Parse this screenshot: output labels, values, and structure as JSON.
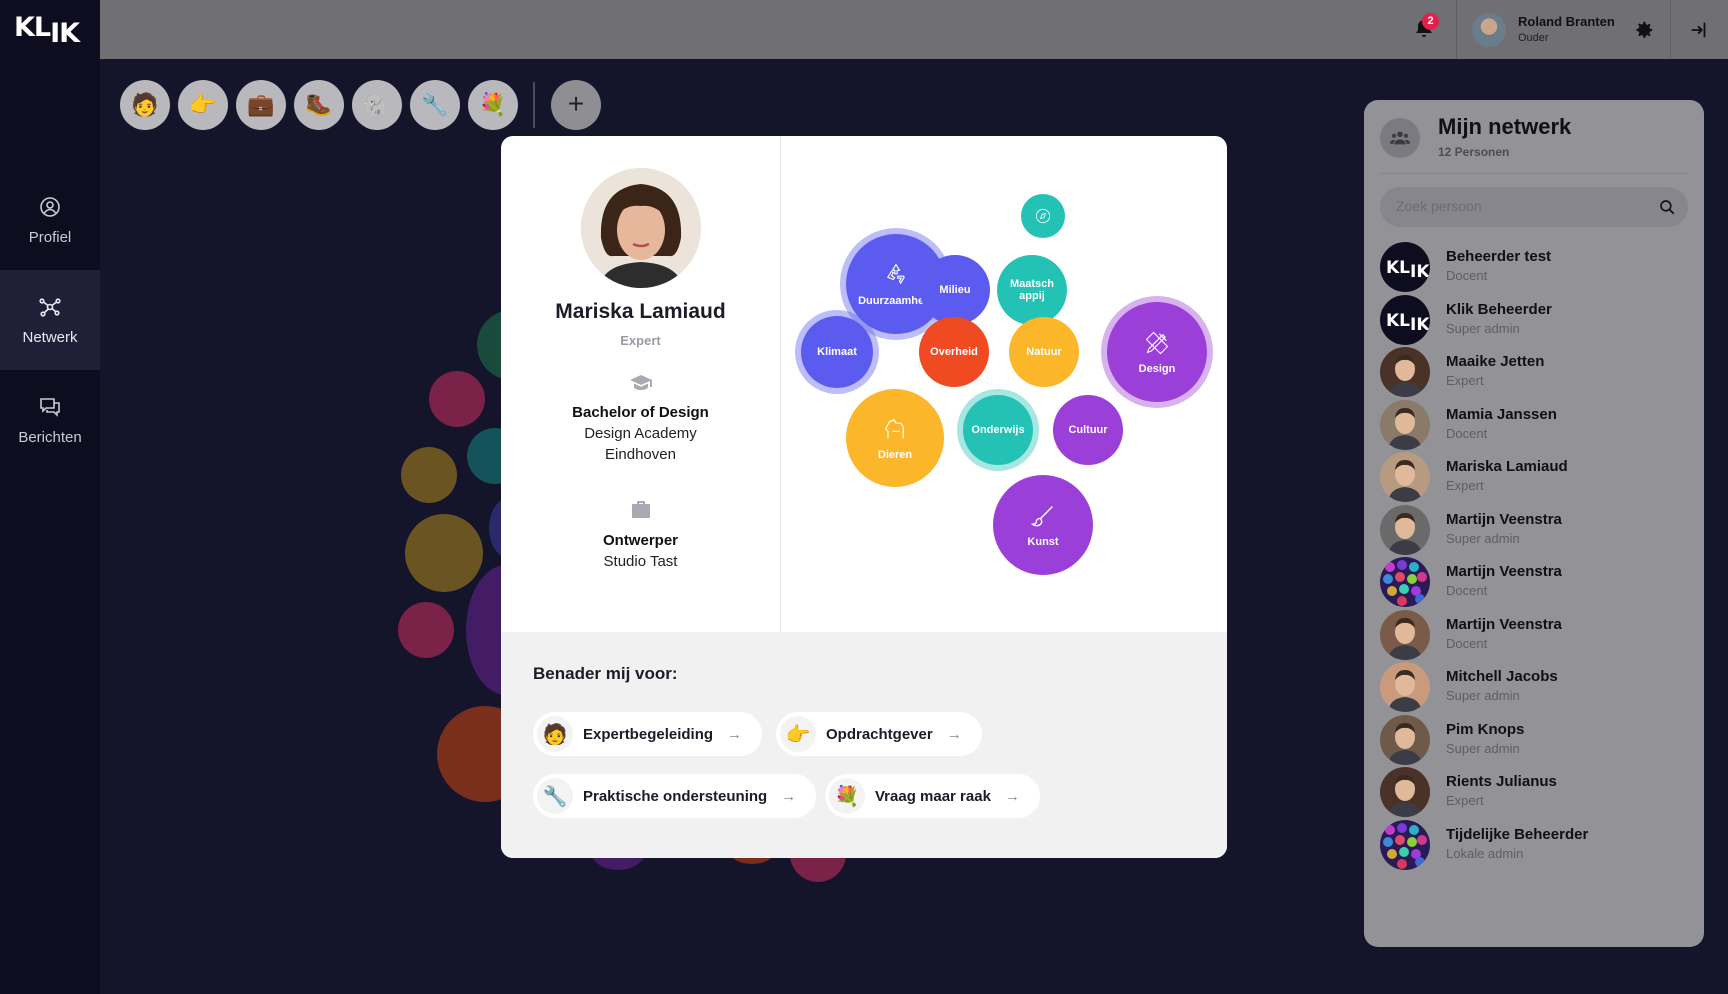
{
  "app": {
    "logo": "KL",
    "logo_b": "IK"
  },
  "nav": [
    {
      "id": "profiel",
      "label": "Profiel",
      "icon": "user-circle-icon"
    },
    {
      "id": "netwerk",
      "label": "Netwerk",
      "icon": "network-icon",
      "active": true
    },
    {
      "id": "berichten",
      "label": "Berichten",
      "icon": "chat-icon"
    }
  ],
  "topbar": {
    "notifications_count": "2",
    "user_name": "Roland Branten",
    "user_role": "Ouder"
  },
  "filters": [
    {
      "name": "expertbegeleiding-filter",
      "glyph": "🧑"
    },
    {
      "name": "opdrachtgever-filter",
      "glyph": "👉"
    },
    {
      "name": "briefcase-filter",
      "glyph": "💼"
    },
    {
      "name": "boot-filter",
      "glyph": "🥾"
    },
    {
      "name": "elephant-filter",
      "glyph": "🐘"
    },
    {
      "name": "praktische-ondersteuning-filter",
      "glyph": "🔧"
    },
    {
      "name": "vraag-maar-raak-filter",
      "glyph": "💐"
    }
  ],
  "add_label": "+",
  "network": {
    "title": "Mijn netwerk",
    "count": "12 Personen",
    "search_placeholder": "Zoek persoon",
    "people": [
      {
        "name": "Beheerder test",
        "role": "Docent",
        "avatar": "logo"
      },
      {
        "name": "Klik Beheerder",
        "role": "Super admin",
        "avatar": "logo"
      },
      {
        "name": "Maaike Jetten",
        "role": "Expert",
        "avatar": "photo"
      },
      {
        "name": "Mamia Janssen",
        "role": "Docent",
        "avatar": "photo"
      },
      {
        "name": "Mariska Lamiaud",
        "role": "Expert",
        "avatar": "photo"
      },
      {
        "name": "Martijn Veenstra",
        "role": "Super admin",
        "avatar": "photo"
      },
      {
        "name": "Martijn Veenstra",
        "role": "Docent",
        "avatar": "dots"
      },
      {
        "name": "Martijn Veenstra",
        "role": "Docent",
        "avatar": "photo"
      },
      {
        "name": "Mitchell Jacobs",
        "role": "Super admin",
        "avatar": "photo"
      },
      {
        "name": "Pim Knops",
        "role": "Super admin",
        "avatar": "photo"
      },
      {
        "name": "Rients Julianus",
        "role": "Expert",
        "avatar": "photo"
      },
      {
        "name": "Tijdelijke Beheerder",
        "role": "Lokale admin",
        "avatar": "dots"
      }
    ]
  },
  "profile": {
    "name": "Mariska Lamiaud",
    "role": "Expert",
    "education_title": "Bachelor of Design",
    "education_school_1": "Design Academy",
    "education_school_2": "Eindhoven",
    "job_title": "Ontwerper",
    "job_company": "Studio Tast"
  },
  "interests": [
    {
      "label": "Duurzaamheid",
      "color": "#5b5bef",
      "icon": "recycle-icon",
      "highlighted": true
    },
    {
      "label": "Milieu",
      "color": "#5b5bef"
    },
    {
      "label": "Maatschappij",
      "color": "#23c2b4"
    },
    {
      "label": "Klimaat",
      "color": "#5b5bef",
      "highlighted": true
    },
    {
      "label": "Overheid",
      "color": "#f04a22"
    },
    {
      "label": "Natuur",
      "color": "#fbb62a"
    },
    {
      "label": "Design",
      "color": "#9a3fd8",
      "icon": "pencil-ruler-icon",
      "highlighted": true
    },
    {
      "label": "Dieren",
      "color": "#fbb62a",
      "icon": "horse-icon"
    },
    {
      "label": "Onderwijs",
      "color": "#23c2b4",
      "highlighted": true
    },
    {
      "label": "Cultuur",
      "color": "#9a3fd8"
    },
    {
      "label": "Kunst",
      "color": "#9a3fd8",
      "icon": "brush-icon"
    },
    {
      "label": "",
      "color": "#23c2b4",
      "icon": "compass-icon"
    }
  ],
  "contact": {
    "heading": "Benader mij voor:",
    "options": [
      {
        "label": "Expertbegeleiding",
        "glyph": "🧑"
      },
      {
        "label": "Opdrachtgever",
        "glyph": "👉"
      },
      {
        "label": "Praktische ondersteuning",
        "glyph": "🔧"
      },
      {
        "label": "Vraag maar raak",
        "glyph": "💐"
      }
    ],
    "arrow": "→"
  }
}
